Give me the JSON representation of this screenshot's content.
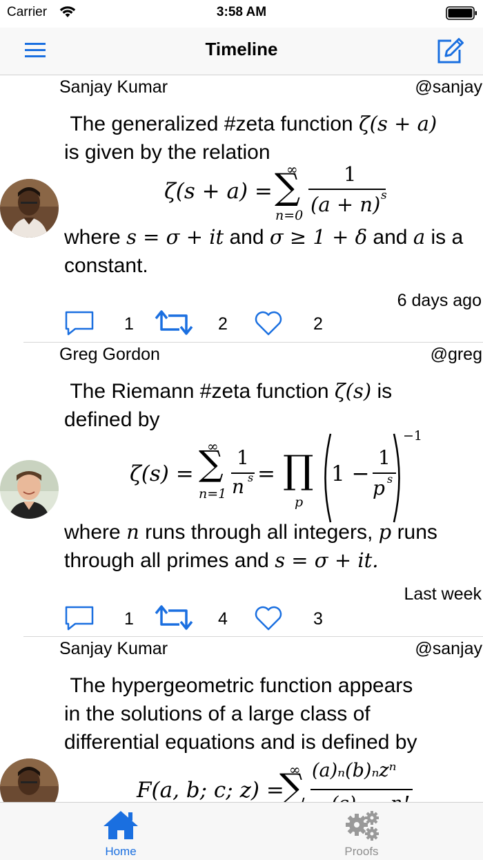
{
  "status_bar": {
    "carrier": "Carrier",
    "time": "3:58 AM"
  },
  "nav": {
    "title": "Timeline",
    "menu_icon": "menu-icon",
    "compose_icon": "compose-icon"
  },
  "accent_color": "#1a6fe0",
  "posts": [
    {
      "author": "Sanjay Kumar",
      "handle": "@sanjay",
      "text_line1": "The generalized #zeta function",
      "inline_math1": "ζ(s + a)",
      "text_line2": "is given by the relation",
      "equation": {
        "lhs": "ζ(s + a) =",
        "sum_upper": "∞",
        "sum_lower": "n=0",
        "numerator": "1",
        "denominator": "(a + n)",
        "denominator_exp": "s"
      },
      "text_where": "where",
      "math_s": "s = σ + it",
      "text_and": "and",
      "math_sigma": "σ ≥ 1 + δ",
      "text_and2": "and",
      "math_a": "a",
      "text_isa": "is a",
      "text_end": "constant.",
      "time": "6 days ago",
      "comments": "1",
      "retweets": "2",
      "likes": "2"
    },
    {
      "author": "Greg Gordon",
      "handle": "@greg",
      "text_line1": "The Riemann #zeta function",
      "inline_math1": "ζ(s)",
      "text_is": "is",
      "text_line2": "defined by",
      "equation": {
        "lhs": "ζ(s) =",
        "sum_upper": "∞",
        "sum_lower": "n=1",
        "frac_num": "1",
        "frac_den": "n",
        "frac_den_exp": "s",
        "eq2": "=",
        "prod_lower": "p",
        "one_minus": "1 −",
        "inner_num": "1",
        "inner_den": "p",
        "inner_den_exp": "s",
        "outer_exp": "−1"
      },
      "text_where": "where",
      "math_n": "n",
      "text_runs": "runs through all integers,",
      "math_p": "p",
      "text_runs2": "runs",
      "text_line4": "through all primes and",
      "math_s": "s = σ + it.",
      "time": "Last week",
      "comments": "1",
      "retweets": "4",
      "likes": "3"
    },
    {
      "author": "Sanjay Kumar",
      "handle": "@sanjay",
      "text_line1": "The hypergeometric function appears",
      "text_line2": "in the solutions of a large class of",
      "text_line3": "differential equations and is defined by",
      "equation": {
        "lhs": "F(a, b; c; z) =",
        "sum_upper": "∞",
        "numerator": "(a)ₙ(b)ₙzⁿ",
        "denominator_left": "(c)ₙ",
        "denominator_right": "n!"
      }
    }
  ],
  "tabs": [
    {
      "label": "Home",
      "icon": "home-icon",
      "active": true
    },
    {
      "label": "Proofs",
      "icon": "gears-icon",
      "active": false
    }
  ]
}
